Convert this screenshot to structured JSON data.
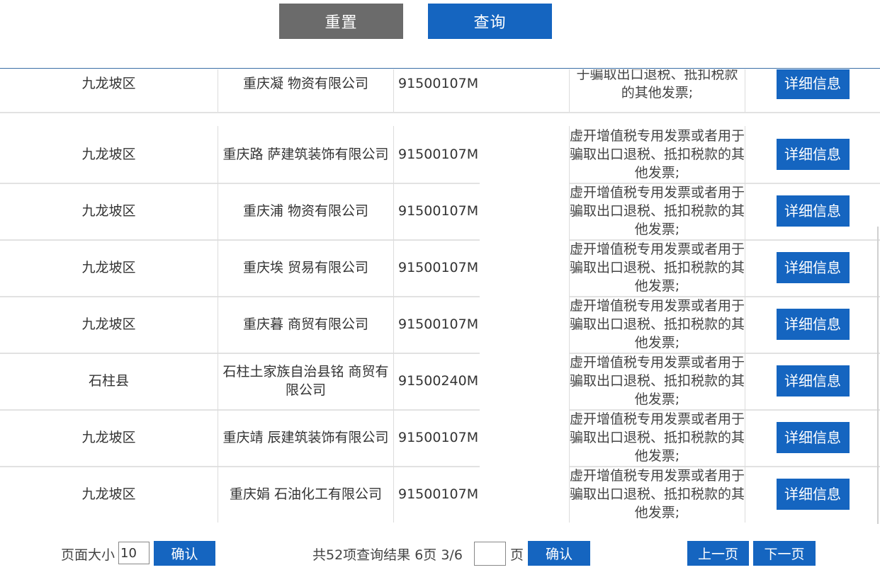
{
  "toolbar": {
    "reset_label": "重置",
    "query_label": "查询"
  },
  "table": {
    "rows": [
      {
        "region": "九龙坡区",
        "company": "重庆凝    物资有限公司",
        "code": "91500107M",
        "reason": "于骗取出口退税、抵扣税款 的其他发票;",
        "action": "详细信息"
      },
      {
        "region": "九龙坡区",
        "company": "重庆路      萨建筑装饰有限公司",
        "code": "91500107M",
        "reason": "虚开增值税专用发票或者用于骗取出口退税、抵扣税款的其他发票;",
        "action": "详细信息"
      },
      {
        "region": "九龙坡区",
        "company": "重庆浦      物资有限公司",
        "code": "91500107M",
        "reason": "虚开增值税专用发票或者用于骗取出口退税、抵扣税款的其他发票;",
        "action": "详细信息"
      },
      {
        "region": "九龙坡区",
        "company": "重庆埃    贸易有限公司",
        "code": "91500107M",
        "reason": "虚开增值税专用发票或者用于骗取出口退税、抵扣税款的其他发票;",
        "action": "详细信息"
      },
      {
        "region": "九龙坡区",
        "company": "重庆暮    商贸有限公司",
        "code": "91500107M",
        "reason": "虚开增值税专用发票或者用于骗取出口退税、抵扣税款的其他发票;",
        "action": "详细信息"
      },
      {
        "region": "石柱县",
        "company": "石柱土家族自治县铭    商贸有限公司",
        "code": "91500240M",
        "reason": "虚开增值税专用发票或者用于骗取出口退税、抵扣税款的其他发票;",
        "action": "详细信息"
      },
      {
        "region": "九龙坡区",
        "company": "重庆靖      辰建筑装饰有限公司",
        "code": "91500107M",
        "reason": "虚开增值税专用发票或者用于骗取出口退税、抵扣税款的其他发票;",
        "action": "详细信息"
      },
      {
        "region": "九龙坡区",
        "company": "重庆娟    石油化工有限公司",
        "code": "91500107M",
        "reason": "虚开增值税专用发票或者用于骗取出口退税、抵扣税款的其他发票;",
        "action": "详细信息"
      }
    ]
  },
  "pager": {
    "page_size_label": "页面大小",
    "page_size_value": "10",
    "confirm_label": "确认",
    "summary": "共52项查询结果 6页 3/6",
    "goto_value": "",
    "page_unit": "页",
    "prev_label": "上一页",
    "next_label": "下一页"
  },
  "colors": {
    "primary": "#1565c0",
    "reset": "#6b6b6b"
  }
}
